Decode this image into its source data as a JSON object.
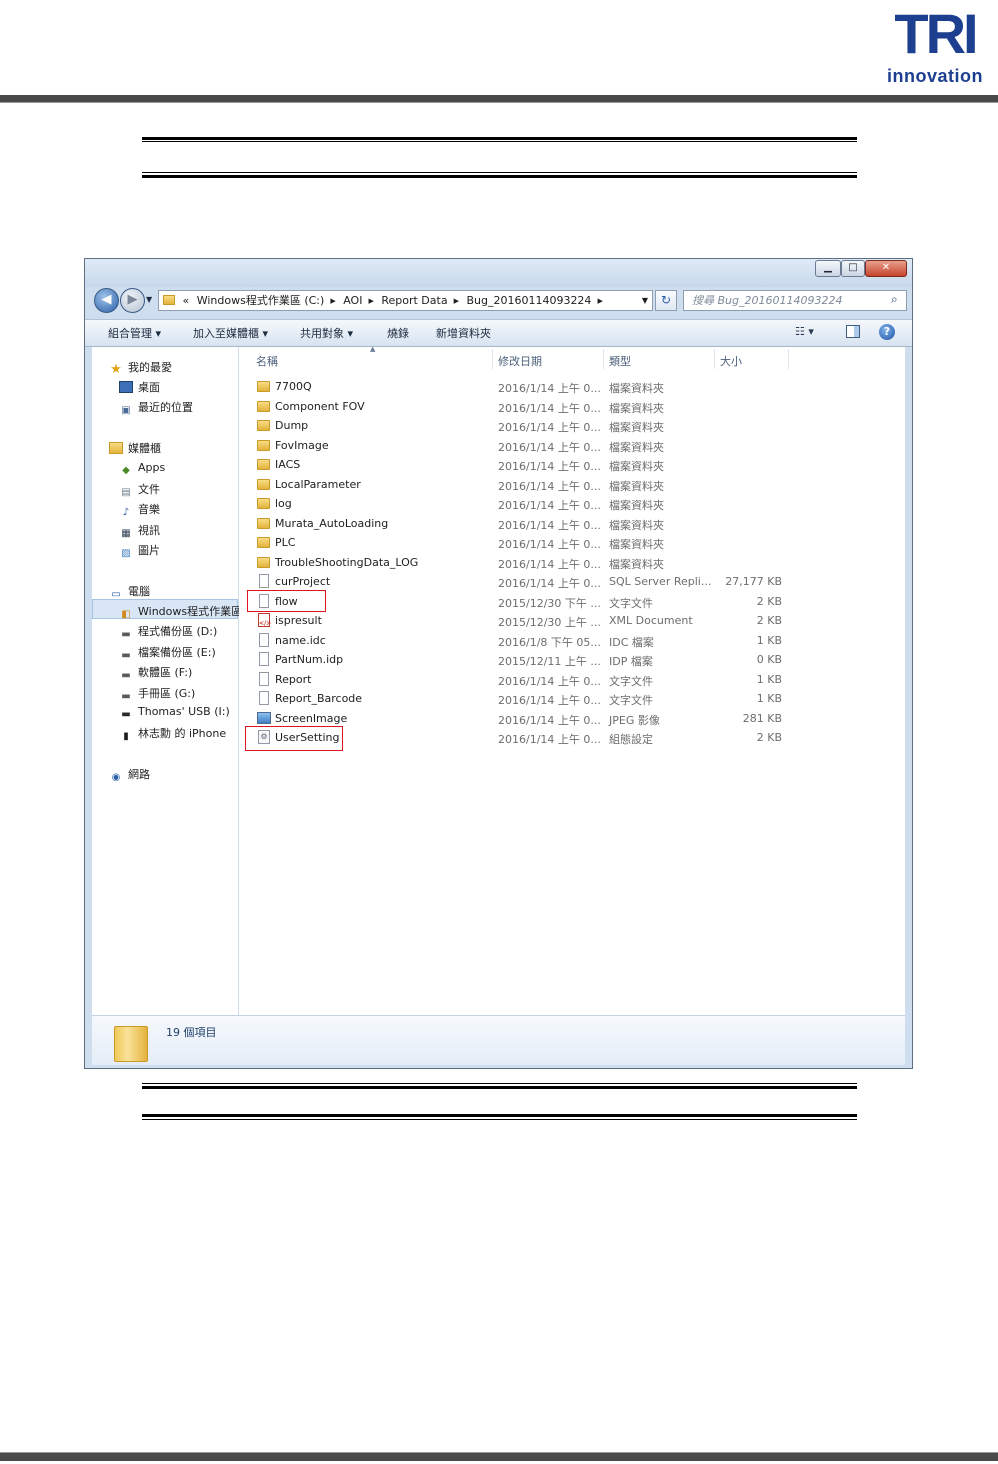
{
  "brand": {
    "logo_main": "TRI",
    "logo_sub": "innovation"
  },
  "window": {
    "buttons": {
      "minimize": "▁",
      "maximize": "□",
      "close": "✕"
    }
  },
  "address": {
    "prefix": "«",
    "segments": [
      "Windows程式作業區 (C:)",
      "AOI",
      "Report Data",
      "Bug_20160114093224"
    ],
    "search_placeholder": "搜尋 Bug_20160114093224"
  },
  "toolbar": {
    "organize": "組合管理 ▾",
    "include_library": "加入至媒體櫃 ▾",
    "share": "共用對象 ▾",
    "burn": "燒錄",
    "new_folder": "新增資料夾",
    "help": "?"
  },
  "nav": {
    "favorites": {
      "label": "我的最愛",
      "items": [
        "桌面",
        "最近的位置"
      ]
    },
    "libraries": {
      "label": "媒體櫃",
      "items": [
        "Apps",
        "文件",
        "音樂",
        "視訊",
        "圖片"
      ]
    },
    "computer": {
      "label": "電腦",
      "items": [
        "Windows程式作業區",
        "程式備份區 (D:)",
        "檔案備份區 (E:)",
        "軟體區 (F:)",
        "手冊區 (G:)",
        "Thomas' USB (I:)",
        "林志勳 的 iPhone"
      ]
    },
    "network": {
      "label": "網路"
    }
  },
  "columns": {
    "name": "名稱",
    "date": "修改日期",
    "type": "類型",
    "size": "大小"
  },
  "files": [
    {
      "name": "7700Q",
      "date": "2016/1/14 上午 0...",
      "type": "檔案資料夾",
      "size": "",
      "icon": "folder"
    },
    {
      "name": "Component FOV",
      "date": "2016/1/14 上午 0...",
      "type": "檔案資料夾",
      "size": "",
      "icon": "folder"
    },
    {
      "name": "Dump",
      "date": "2016/1/14 上午 0...",
      "type": "檔案資料夾",
      "size": "",
      "icon": "folder"
    },
    {
      "name": "FovImage",
      "date": "2016/1/14 上午 0...",
      "type": "檔案資料夾",
      "size": "",
      "icon": "folder"
    },
    {
      "name": "IACS",
      "date": "2016/1/14 上午 0...",
      "type": "檔案資料夾",
      "size": "",
      "icon": "folder"
    },
    {
      "name": "LocalParameter",
      "date": "2016/1/14 上午 0...",
      "type": "檔案資料夾",
      "size": "",
      "icon": "folder"
    },
    {
      "name": "log",
      "date": "2016/1/14 上午 0...",
      "type": "檔案資料夾",
      "size": "",
      "icon": "folder"
    },
    {
      "name": "Murata_AutoLoading",
      "date": "2016/1/14 上午 0...",
      "type": "檔案資料夾",
      "size": "",
      "icon": "folder"
    },
    {
      "name": "PLC",
      "date": "2016/1/14 上午 0...",
      "type": "檔案資料夾",
      "size": "",
      "icon": "folder"
    },
    {
      "name": "TroubleShootingData_LOG",
      "date": "2016/1/14 上午 0...",
      "type": "檔案資料夾",
      "size": "",
      "icon": "folder"
    },
    {
      "name": "curProject",
      "date": "2016/1/14 上午 0...",
      "type": "SQL Server Repli...",
      "size": "27,177 KB",
      "icon": "file"
    },
    {
      "name": "flow",
      "date": "2015/12/30 下午 ...",
      "type": "文字文件",
      "size": "2 KB",
      "icon": "file"
    },
    {
      "name": "ispresult",
      "date": "2015/12/30 上午 ...",
      "type": "XML Document",
      "size": "2 KB",
      "icon": "xml"
    },
    {
      "name": "name.idc",
      "date": "2016/1/8 下午 05...",
      "type": "IDC 檔案",
      "size": "1 KB",
      "icon": "file"
    },
    {
      "name": "PartNum.idp",
      "date": "2015/12/11 上午 ...",
      "type": "IDP 檔案",
      "size": "0 KB",
      "icon": "file"
    },
    {
      "name": "Report",
      "date": "2016/1/14 上午 0...",
      "type": "文字文件",
      "size": "1 KB",
      "icon": "file"
    },
    {
      "name": "Report_Barcode",
      "date": "2016/1/14 上午 0...",
      "type": "文字文件",
      "size": "1 KB",
      "icon": "file"
    },
    {
      "name": "ScreenImage",
      "date": "2016/1/14 上午 0...",
      "type": "JPEG 影像",
      "size": "281 KB",
      "icon": "image"
    },
    {
      "name": "UserSetting",
      "date": "2016/1/14 上午 0...",
      "type": "組態設定",
      "size": "2 KB",
      "icon": "config"
    }
  ],
  "status": {
    "item_count": "19 個項目"
  },
  "colors": {
    "logo": "#1d3f8f",
    "highlight": "#e0141e",
    "frame": "#cfdeee"
  }
}
